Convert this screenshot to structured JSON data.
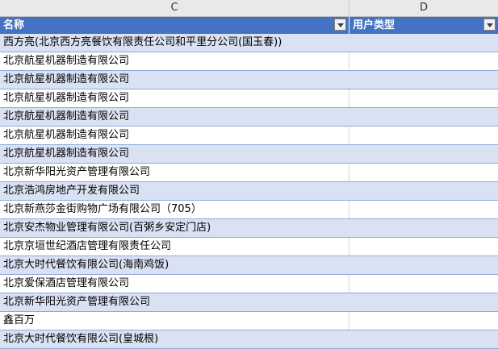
{
  "columns": {
    "c_letter": "C",
    "d_letter": "D"
  },
  "header": {
    "name": "名称",
    "user_type": "用户类型"
  },
  "rows": [
    {
      "name": "西方亮(北京西方亮餐饮有限责任公司和平里分公司(国玉春))",
      "user_type": ""
    },
    {
      "name": "北京航星机器制造有限公司",
      "user_type": ""
    },
    {
      "name": "北京航星机器制造有限公司",
      "user_type": ""
    },
    {
      "name": "北京航星机器制造有限公司",
      "user_type": ""
    },
    {
      "name": "北京航星机器制造有限公司",
      "user_type": ""
    },
    {
      "name": "北京航星机器制造有限公司",
      "user_type": ""
    },
    {
      "name": "北京航星机器制造有限公司",
      "user_type": ""
    },
    {
      "name": "北京新华阳光资产管理有限公司",
      "user_type": ""
    },
    {
      "name": "北京浩鸿房地产开发有限公司",
      "user_type": ""
    },
    {
      "name": "北京新燕莎金街购物广场有限公司（705）",
      "user_type": ""
    },
    {
      "name": "北京安杰物业管理有限公司(百粥乡安定门店)",
      "user_type": ""
    },
    {
      "name": "北京京垣世纪酒店管理有限责任公司",
      "user_type": ""
    },
    {
      "name": "北京大时代餐饮有限公司(海南鸡饭)",
      "user_type": ""
    },
    {
      "name": "北京爱保酒店管理有限公司",
      "user_type": ""
    },
    {
      "name": "北京新华阳光资产管理有限公司",
      "user_type": ""
    },
    {
      "name": "鑫百万",
      "user_type": ""
    },
    {
      "name": "北京大时代餐饮有限公司(皇城根)",
      "user_type": ""
    }
  ],
  "colors": {
    "header_bg": "#4472c4",
    "band_bg": "#d9e1f2",
    "row_border": "#8eaadb"
  }
}
